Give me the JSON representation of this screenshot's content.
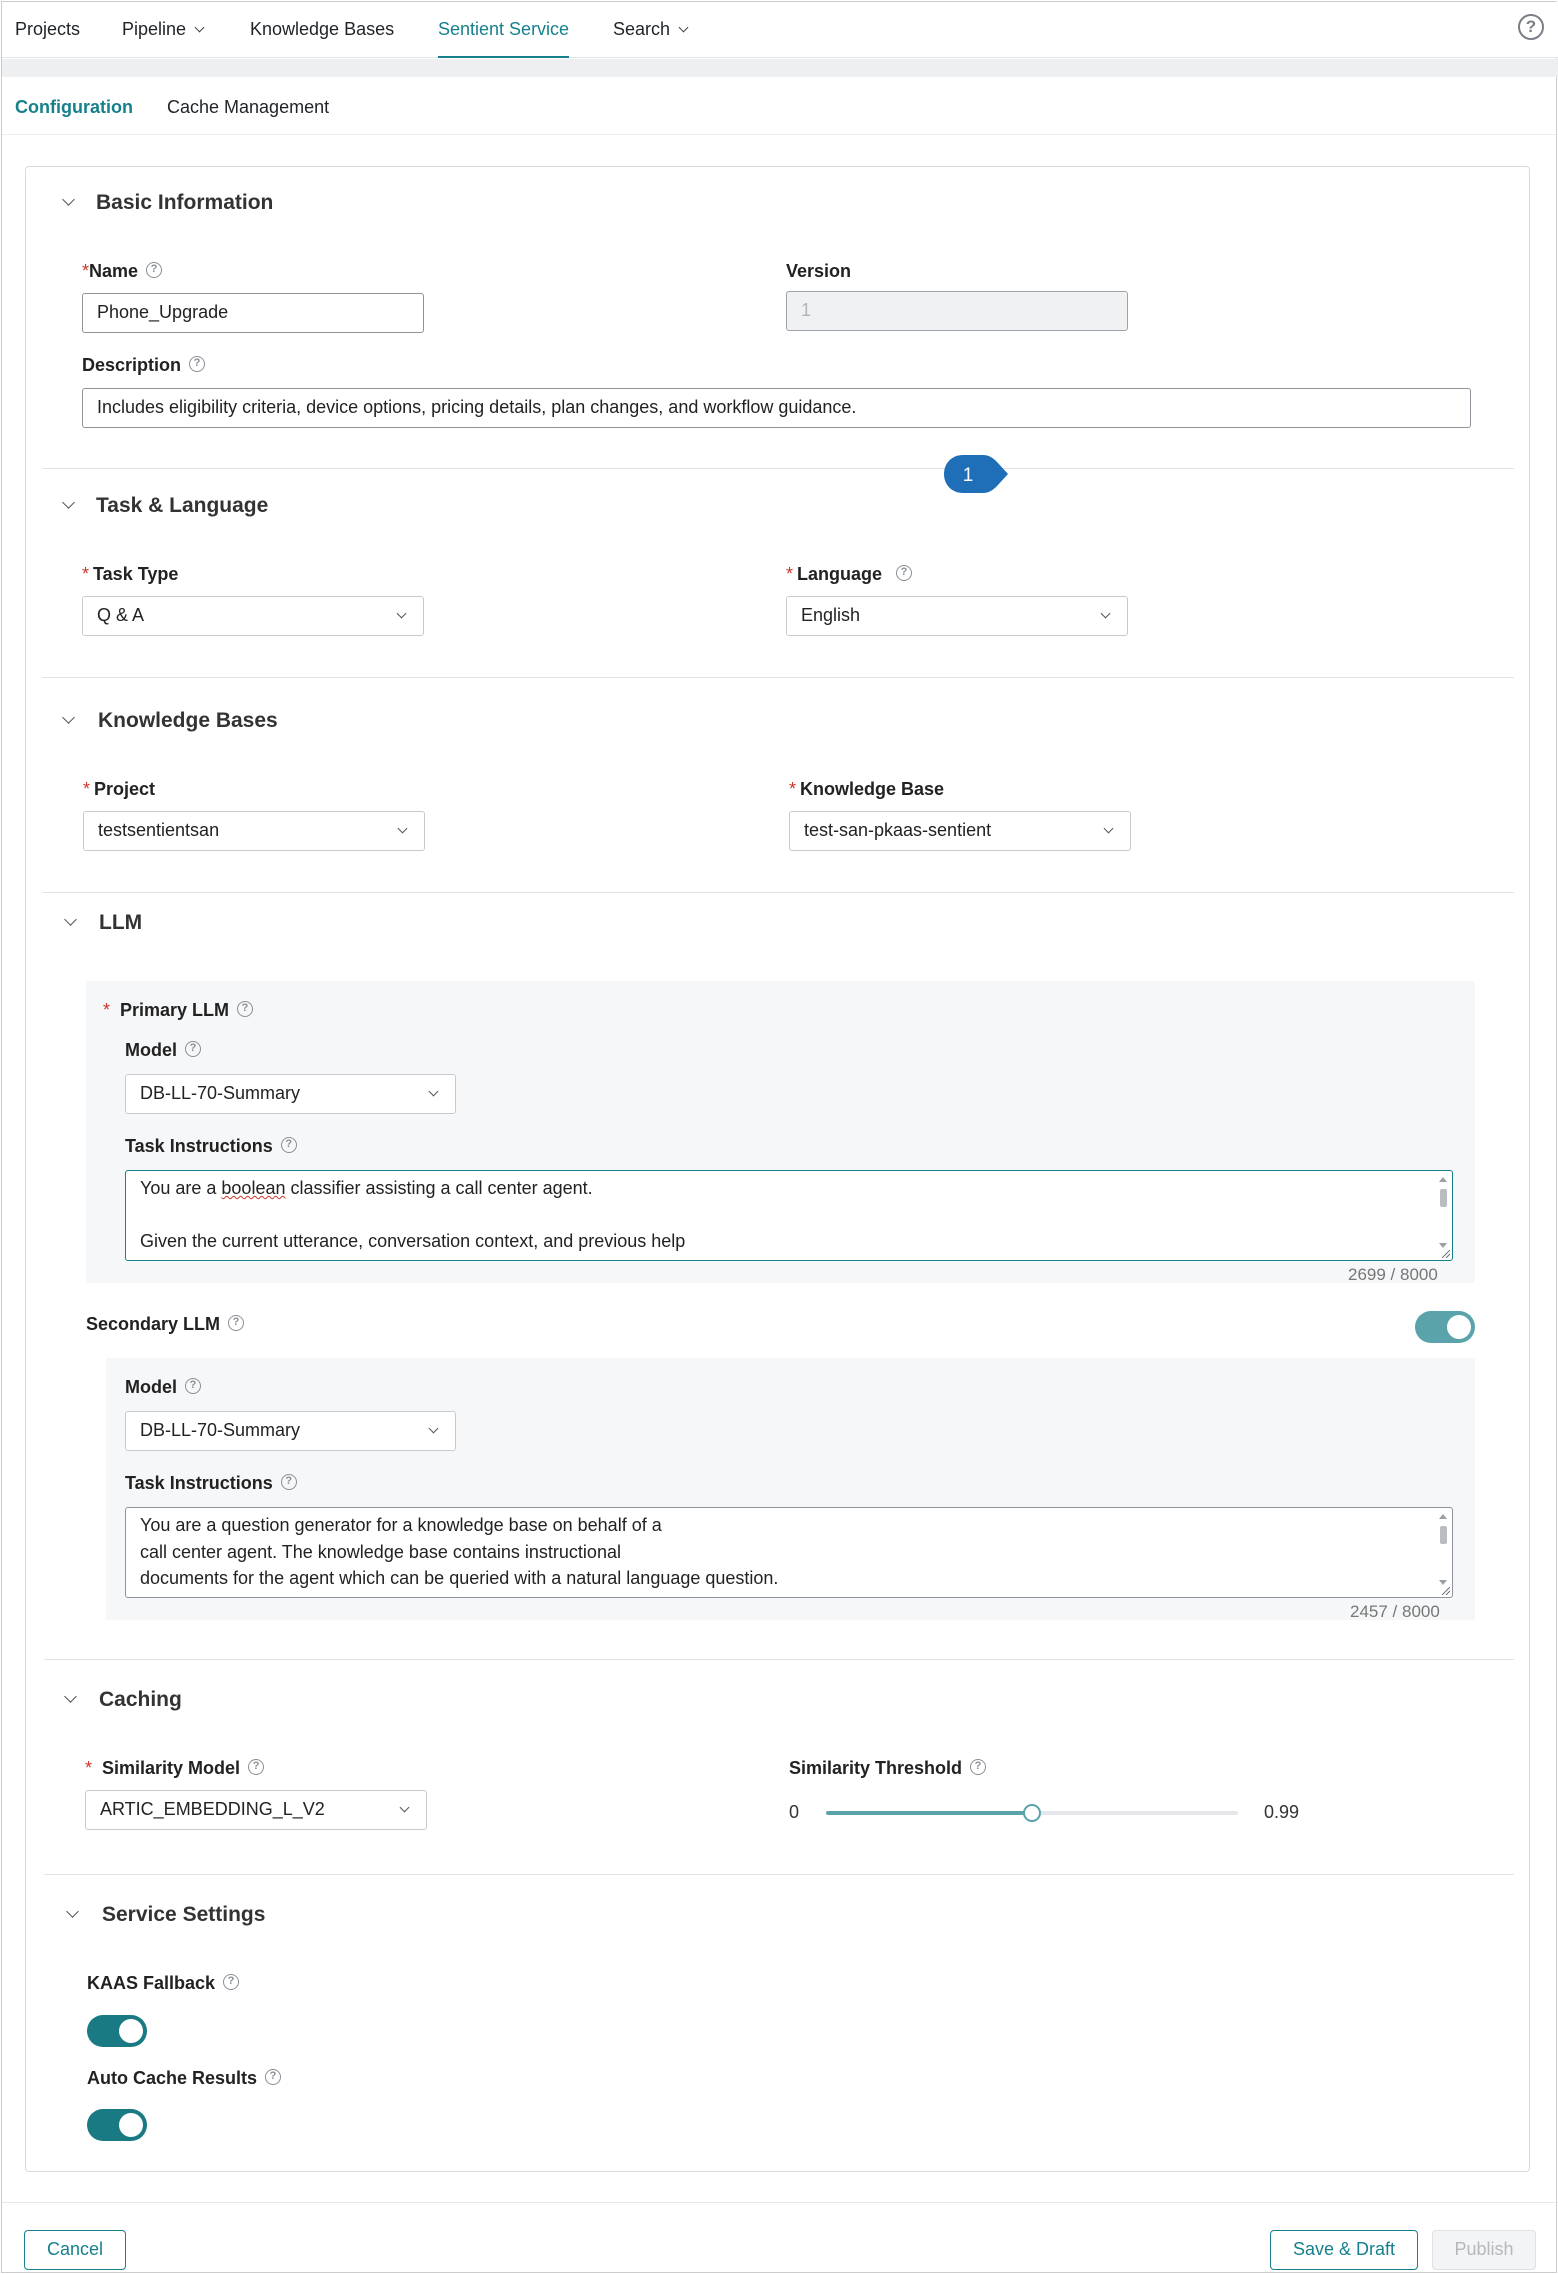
{
  "nav": {
    "items": [
      {
        "label": "Projects"
      },
      {
        "label": "Pipeline"
      },
      {
        "label": "Knowledge Bases"
      },
      {
        "label": "Sentient Service"
      },
      {
        "label": "Search"
      }
    ],
    "help_icon": "?"
  },
  "subtabs": {
    "configuration": "Configuration",
    "cache": "Cache Management"
  },
  "basic": {
    "title": "Basic Information",
    "name_label": "Name",
    "name_value": "Phone_Upgrade",
    "version_label": "Version",
    "version_value": "1",
    "description_label": "Description",
    "description_value": "Includes eligibility criteria, device options, pricing details, plan changes, and workflow guidance."
  },
  "task": {
    "title": "Task & Language",
    "task_type_label": "Task Type",
    "task_type_value": "Q & A",
    "language_label": "Language",
    "language_value": "English"
  },
  "badge": {
    "number": "1"
  },
  "kb": {
    "title": "Knowledge Bases",
    "project_label": "Project",
    "project_value": "testsentientsan",
    "kb_label": "Knowledge Base",
    "kb_value": "test-san-pkaas-sentient"
  },
  "llm": {
    "title": "LLM",
    "primary": {
      "label": "Primary LLM",
      "model_label": "Model",
      "model_value": "DB-LL-70-Summary",
      "instr_label": "Task Instructions",
      "instr_line1_pre": "You are a ",
      "instr_line1_spell": "boolean",
      "instr_line1_post": " classifier assisting a call center agent.",
      "instr_line3": "Given the current utterance, conversation context, and previous help",
      "counter": "2699 / 8000"
    },
    "secondary": {
      "label": "Secondary LLM",
      "enabled": true,
      "model_label": "Model",
      "model_value": "DB-LL-70-Summary",
      "instr_label": "Task Instructions",
      "instr_lines": [
        "You are a question generator for a knowledge base on behalf of a",
        "call center agent. The knowledge base contains instructional",
        "documents for the agent which can be queried with a natural language question."
      ],
      "counter": "2457 / 8000"
    }
  },
  "caching": {
    "title": "Caching",
    "similarity_model_label": "Similarity Model",
    "similarity_model_value": "ARTIC_EMBEDDING_L_V2",
    "threshold_label": "Similarity Threshold",
    "threshold_min": "0",
    "threshold_max": "0.99",
    "threshold_fraction": 0.5
  },
  "service": {
    "title": "Service Settings",
    "kaas_label": "KAAS Fallback",
    "kaas_enabled": true,
    "auto_cache_label": "Auto Cache Results",
    "auto_cache_enabled": true
  },
  "footer": {
    "cancel": "Cancel",
    "save": "Save & Draft",
    "publish": "Publish"
  },
  "colors": {
    "accent": "#16818c",
    "required": "#d0342c",
    "badge": "#1f6fb8"
  }
}
